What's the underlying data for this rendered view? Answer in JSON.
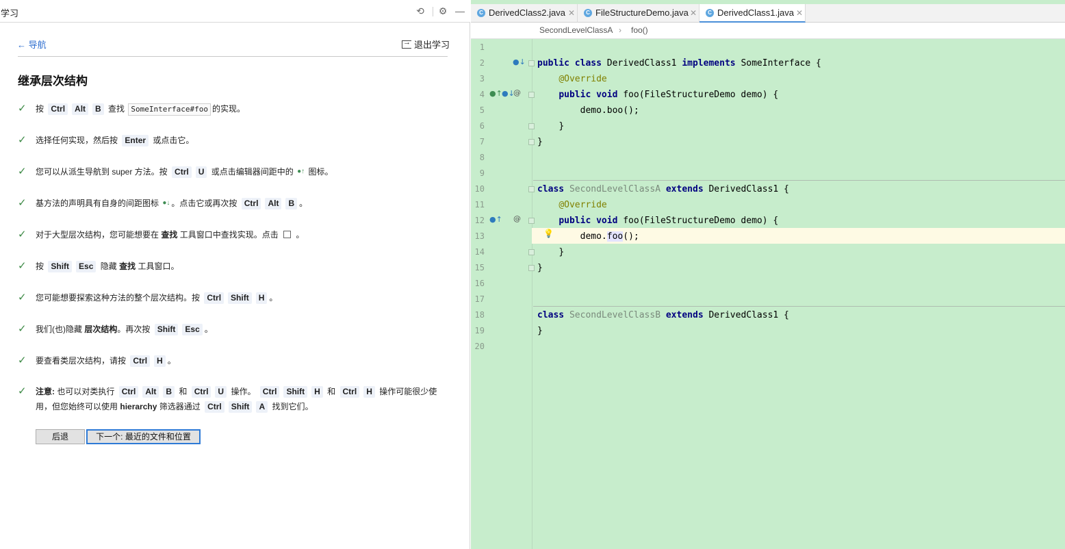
{
  "learn": {
    "panel_title": "学习",
    "nav_back": "← 导航",
    "exit_label": "退出学习",
    "lesson_title": "继承层次结构",
    "steps": [
      {
        "parts": [
          "按",
          "Ctrl",
          "Alt",
          "B",
          "查找",
          "SomeInterface#foo",
          "的实现。"
        ]
      },
      {
        "parts": [
          "选择任何实现，然后按",
          "Enter",
          "或点击它。"
        ]
      },
      {
        "parts": [
          "您可以从派生导航到 super 方法。按",
          "Ctrl",
          "U",
          "或点击编辑器间距中的",
          "图标。"
        ]
      },
      {
        "parts": [
          "基方法的声明具有自身的间距图标",
          "。点击它或再次按",
          "Ctrl",
          "Alt",
          "B",
          "。"
        ]
      },
      {
        "parts": [
          "对于大型层次结构，您可能想要在",
          "查找",
          "工具窗口中查找实现。点击",
          "。"
        ]
      },
      {
        "parts": [
          "按",
          "Shift",
          "Esc",
          "隐藏",
          "查找",
          "工具窗口。"
        ]
      },
      {
        "parts": [
          "您可能想要探索这种方法的整个层次结构。按",
          "Ctrl",
          "Shift",
          "H",
          "。"
        ]
      },
      {
        "parts": [
          "我们(也)隐藏",
          "层次结构",
          "。再次按",
          "Shift",
          "Esc",
          "。"
        ]
      },
      {
        "parts": [
          "要查看类层次结构，请按",
          "Ctrl",
          "H",
          "。"
        ]
      },
      {
        "parts": [
          "注意:",
          "也可以对类执行",
          "Ctrl",
          "Alt",
          "B",
          "和",
          "Ctrl",
          "U",
          "操作。",
          "Ctrl",
          "Shift",
          "H",
          "和",
          "Ctrl",
          "H",
          "操作可能很少使",
          "用，但您始终可以使用",
          "hierarchy",
          "筛选器通过",
          "Ctrl",
          "Shift",
          "A",
          "找到它们。"
        ]
      }
    ],
    "back_button": "后退",
    "next_button": "下一个: 最近的文件和位置"
  },
  "editor": {
    "tabs": [
      {
        "label": "DerivedClass2.java"
      },
      {
        "label": "FileStructureDemo.java"
      },
      {
        "label": "DerivedClass1.java"
      }
    ],
    "breadcrumb": [
      "SecondLevelClassA",
      "foo()"
    ],
    "line_numbers": [
      "1",
      "2",
      "3",
      "4",
      "5",
      "6",
      "7",
      "8",
      "9",
      "10",
      "11",
      "12",
      "13",
      "14",
      "15",
      "16",
      "17",
      "18",
      "19",
      "20"
    ],
    "code": {
      "l2_kw1": "public class",
      "l2_name": "DerivedClass1",
      "l2_kw2": "implements",
      "l2_rest": "SomeInterface {",
      "l3": "@Override",
      "l4_kw": "public void",
      "l4_rest": "foo(FileStructureDemo demo) {",
      "l5": "demo.boo();",
      "l6": "}",
      "l7": "}",
      "l10_kw1": "class",
      "l10_name": "SecondLevelClassA",
      "l10_kw2": "extends",
      "l10_rest": "DerivedClass1 {",
      "l11": "@Override",
      "l12_kw": "public void",
      "l12_rest": "foo(FileStructureDemo demo) {",
      "l13_a": "demo.",
      "l13_b": "foo",
      "l13_c": "();",
      "l14": "}",
      "l15": "}",
      "l18_kw1": "class",
      "l18_name": "SecondLevelClassB",
      "l18_kw2": "extends",
      "l18_rest": "DerivedClass1 {",
      "l19": "}"
    }
  },
  "colors": {
    "editor_bg": "#c7edcc",
    "current_line": "#fefae4",
    "keyword": "#000080",
    "annotation": "#808000",
    "check": "#3d8a46",
    "link": "#2f6fd0"
  }
}
